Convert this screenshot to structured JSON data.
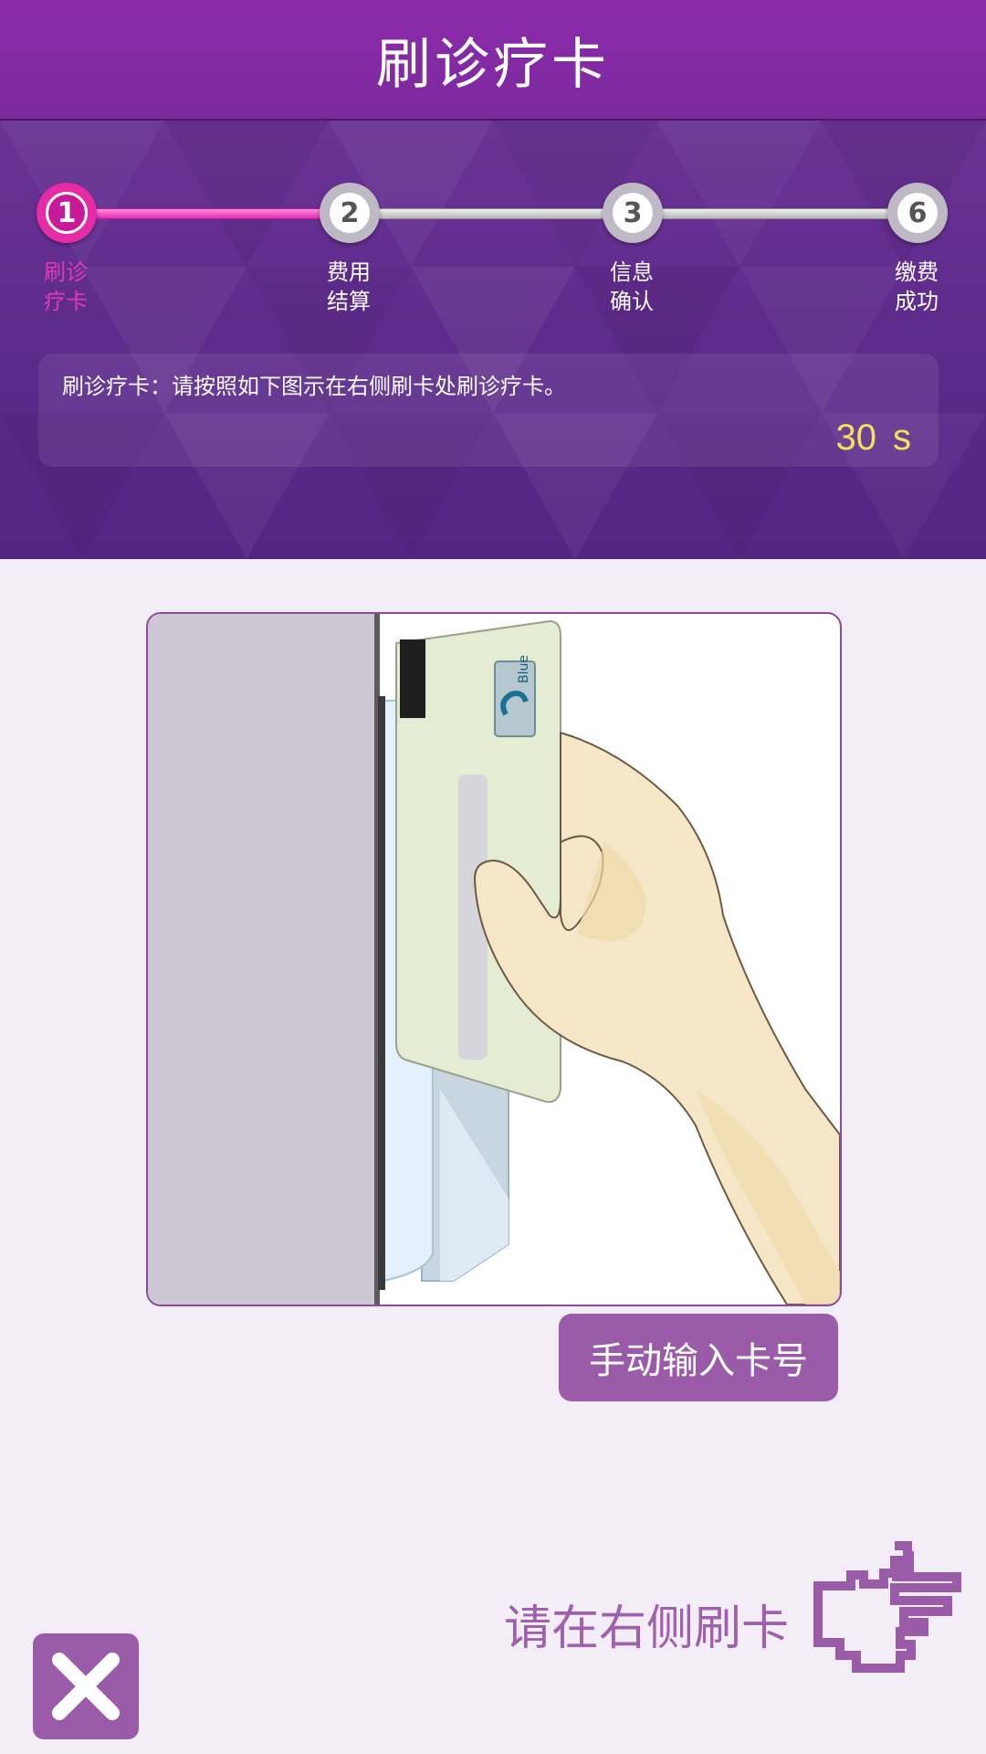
{
  "header": {
    "title": "刷诊疗卡"
  },
  "steps": [
    {
      "number": "1",
      "line1": "刷诊",
      "line2": "疗卡",
      "active": true
    },
    {
      "number": "2",
      "line1": "费用",
      "line2": "结算",
      "active": false
    },
    {
      "number": "3",
      "line1": "信息",
      "line2": "确认",
      "active": false
    },
    {
      "number": "6",
      "line1": "缴费",
      "line2": "成功",
      "active": false
    }
  ],
  "info": {
    "instruction": "刷诊疗卡：请按照如下图示在右侧刷卡处刷诊疗卡。",
    "countdown": "30",
    "countdown_unit": "s"
  },
  "illustration": {
    "card_brand": "Blue"
  },
  "actions": {
    "manual_input_label": "手动输入卡号",
    "prompt_text": "请在右侧刷卡"
  },
  "icons": {
    "close": "close-icon",
    "pointing_hand": "pointing-hand-icon"
  },
  "colors": {
    "header": "#8d2aab",
    "active_step": "#e52ba5",
    "timer": "#f5e05a",
    "button": "#9a5ca8",
    "prompt": "#9f61ad"
  }
}
